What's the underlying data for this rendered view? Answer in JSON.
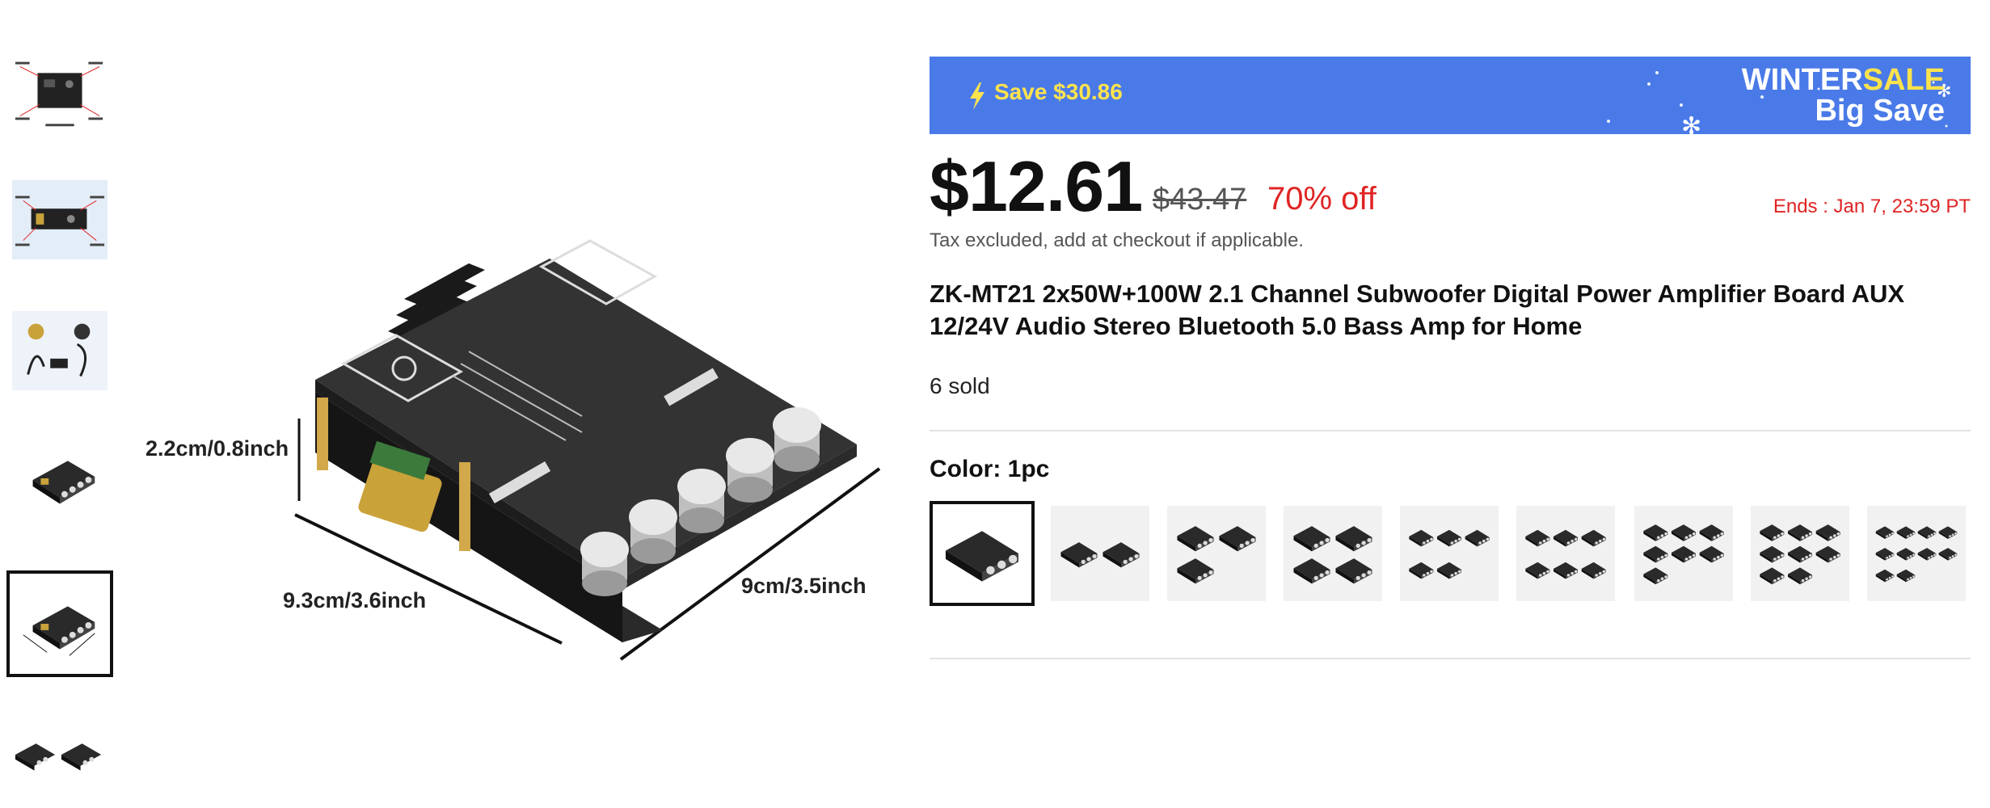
{
  "gallery": {
    "thumbnails": [
      {
        "name": "thumb-interface-diagram",
        "selected": false
      },
      {
        "name": "thumb-connection-diagram",
        "selected": false
      },
      {
        "name": "thumb-accessories",
        "selected": false
      },
      {
        "name": "thumb-board-angle",
        "selected": false
      },
      {
        "name": "thumb-board-dimensions",
        "selected": true
      },
      {
        "name": "thumb-two-boards",
        "selected": false
      }
    ],
    "main_image": {
      "board_model": "ZK-MT21",
      "dimensions": {
        "height": "2.2cm/0.8inch",
        "width": "9.3cm/3.6inch",
        "depth": "9cm/3.5inch"
      }
    }
  },
  "promo": {
    "save_text": "Save $30.86",
    "sale_word1": "WINTER",
    "sale_word2": "SALE",
    "sale_line2": "Big Save",
    "bg_color": "#4a7ae8",
    "accent_color": "#ffe34d"
  },
  "pricing": {
    "current": "$12.61",
    "original": "$43.47",
    "discount": "70% off",
    "ends": "Ends :  Jan 7, 23:59 PT",
    "tax_note": "Tax excluded, add at checkout if applicable.",
    "sale_color": "#e02424"
  },
  "product": {
    "title": "ZK-MT21 2x50W+100W 2.1 Channel Subwoofer Digital Power Amplifier Board AUX 12/24V Audio Stereo Bluetooth 5.0 Bass Amp for Home",
    "sold": "6 sold"
  },
  "color_option": {
    "label": "Color: 1pc",
    "swatches": [
      {
        "option": "1pc",
        "boards": 1,
        "selected": true
      },
      {
        "option": "2pc",
        "boards": 2,
        "selected": false
      },
      {
        "option": "3pc",
        "boards": 3,
        "selected": false
      },
      {
        "option": "4pc",
        "boards": 4,
        "selected": false
      },
      {
        "option": "5pc",
        "boards": 5,
        "selected": false
      },
      {
        "option": "6pc",
        "boards": 6,
        "selected": false
      },
      {
        "option": "7pc",
        "boards": 7,
        "selected": false
      },
      {
        "option": "8pc",
        "boards": 8,
        "selected": false
      },
      {
        "option": "10pc",
        "boards": 10,
        "selected": false
      }
    ]
  }
}
